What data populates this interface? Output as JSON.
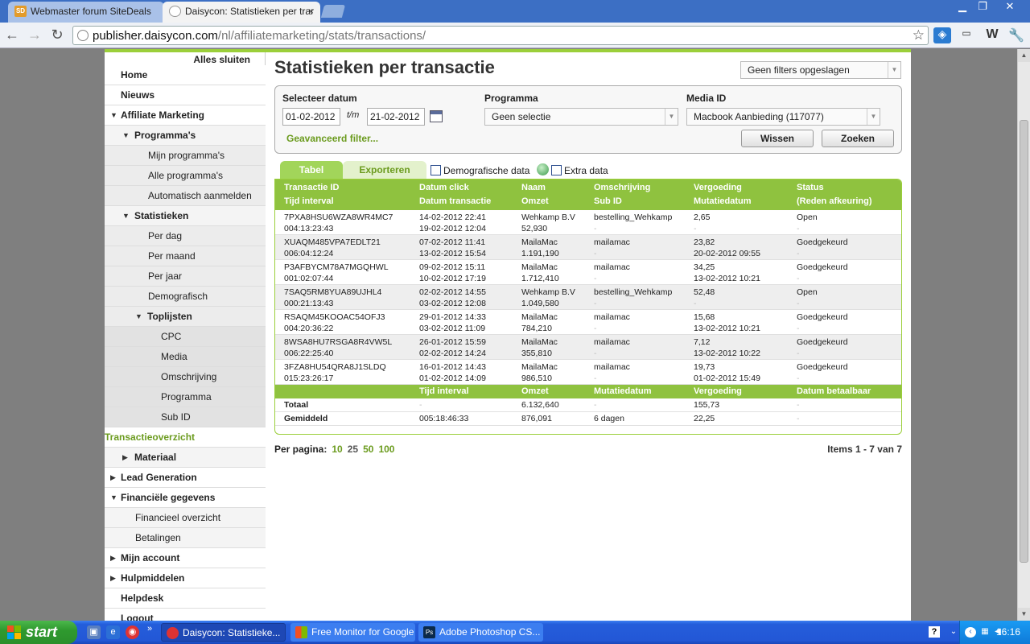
{
  "browser": {
    "tabs": [
      {
        "title": "Webmaster forum SiteDeals",
        "favicon": "SD"
      },
      {
        "title": "Daisycon: Statistieken per trar",
        "close": "×"
      }
    ],
    "window_controls": {
      "minimize": "▁",
      "maximize": "❐",
      "close": "✕"
    },
    "url_host": "publisher.daisycon.com",
    "url_path": "/nl/affiliatemarketing/stats/transactions/"
  },
  "sidebar": {
    "close_all": "Alles sluiten",
    "items": [
      {
        "label": "Home",
        "level": "l0",
        "arrow": ""
      },
      {
        "label": "Nieuws",
        "level": "l0",
        "arrow": ""
      },
      {
        "label": "Affiliate Marketing",
        "level": "l0",
        "arrow": "▼"
      },
      {
        "label": "Programma's",
        "level": "l1",
        "arrow": "▼"
      },
      {
        "label": "Mijn programma's",
        "level": "l2",
        "arrow": ""
      },
      {
        "label": "Alle programma's",
        "level": "l2",
        "arrow": ""
      },
      {
        "label": "Automatisch aanmelden",
        "level": "l2",
        "arrow": ""
      },
      {
        "label": "Statistieken",
        "level": "l1",
        "arrow": "▼"
      },
      {
        "label": "Per dag",
        "level": "l2",
        "arrow": ""
      },
      {
        "label": "Per maand",
        "level": "l2",
        "arrow": ""
      },
      {
        "label": "Per jaar",
        "level": "l2",
        "arrow": ""
      },
      {
        "label": "Demografisch",
        "level": "l2",
        "arrow": ""
      },
      {
        "label": "Toplijsten",
        "level": "l2b",
        "arrow": "▼"
      },
      {
        "label": "CPC",
        "level": "l3",
        "arrow": ""
      },
      {
        "label": "Media",
        "level": "l3",
        "arrow": ""
      },
      {
        "label": "Omschrijving",
        "level": "l3",
        "arrow": ""
      },
      {
        "label": "Programma",
        "level": "l3",
        "arrow": ""
      },
      {
        "label": "Sub ID",
        "level": "l3",
        "arrow": ""
      },
      {
        "label": "Transactieoverzicht",
        "level": "active",
        "arrow": ""
      },
      {
        "label": "Materiaal",
        "level": "l1",
        "arrow": "▶"
      },
      {
        "label": "Lead Generation",
        "level": "l0",
        "arrow": "▶"
      },
      {
        "label": "Financiële gegevens",
        "level": "l0",
        "arrow": "▼"
      },
      {
        "label": "Financieel overzicht",
        "level": "sub",
        "arrow": ""
      },
      {
        "label": "Betalingen",
        "level": "sub",
        "arrow": ""
      },
      {
        "label": "Mijn account",
        "level": "l0",
        "arrow": "▶"
      },
      {
        "label": "Hulpmiddelen",
        "level": "l0",
        "arrow": "▶"
      },
      {
        "label": "Helpdesk",
        "level": "l0",
        "arrow": ""
      },
      {
        "label": "Logout",
        "level": "l0",
        "arrow": ""
      }
    ]
  },
  "main": {
    "title": "Statistieken per transactie",
    "saved_filters": "Geen filters opgeslagen",
    "filter": {
      "date_label": "Selecteer datum",
      "date_from": "01-02-2012",
      "date_sep": "t/m",
      "date_to": "21-02-2012",
      "program_label": "Programma",
      "program_value": "Geen selectie",
      "media_label": "Media ID",
      "media_value": "Macbook Aanbieding (117077)",
      "advanced": "Geavanceerd filter...",
      "clear": "Wissen",
      "search": "Zoeken"
    },
    "view_tabs": {
      "table": "Tabel",
      "export": "Exporteren"
    },
    "checkboxes": {
      "demographic": "Demografische data",
      "extra": "Extra data"
    },
    "table": {
      "headers": [
        [
          "Transactie ID",
          "Tijd interval"
        ],
        [
          "Datum click",
          "Datum transactie"
        ],
        [
          "Naam",
          "Omzet"
        ],
        [
          "Omschrijving",
          "Sub ID"
        ],
        [
          "Vergoeding",
          "Mutatiedatum"
        ],
        [
          "Status",
          "(Reden afkeuring)"
        ]
      ],
      "rows": [
        [
          [
            "7PXA8HSU6WZA8WR4MC7",
            "004:13:23:43"
          ],
          [
            "14-02-2012 22:41",
            "19-02-2012 12:04"
          ],
          [
            "Wehkamp B.V",
            "52,930"
          ],
          [
            "bestelling_Wehkamp",
            "-"
          ],
          [
            "2,65",
            "-"
          ],
          [
            "Open",
            "-"
          ]
        ],
        [
          [
            "XUAQM485VPA7EDLT21",
            "006:04:12:24"
          ],
          [
            "07-02-2012 11:41",
            "13-02-2012 15:54"
          ],
          [
            "MailaMac",
            "1.191,190"
          ],
          [
            "mailamac",
            "-"
          ],
          [
            "23,82",
            "20-02-2012 09:55"
          ],
          [
            "Goedgekeurd",
            "-"
          ]
        ],
        [
          [
            "P3AFBYCM78A7MGQHWL",
            "001:02:07:44"
          ],
          [
            "09-02-2012 15:11",
            "10-02-2012 17:19"
          ],
          [
            "MailaMac",
            "1.712,410"
          ],
          [
            "mailamac",
            "-"
          ],
          [
            "34,25",
            "13-02-2012 10:21"
          ],
          [
            "Goedgekeurd",
            "-"
          ]
        ],
        [
          [
            "7SAQ5RM8YUA89UJHL4",
            "000:21:13:43"
          ],
          [
            "02-02-2012 14:55",
            "03-02-2012 12:08"
          ],
          [
            "Wehkamp B.V",
            "1.049,580"
          ],
          [
            "bestelling_Wehkamp",
            "-"
          ],
          [
            "52,48",
            "-"
          ],
          [
            "Open",
            "-"
          ]
        ],
        [
          [
            "RSAQM45KOOAC54OFJ3",
            "004:20:36:22"
          ],
          [
            "29-01-2012 14:33",
            "03-02-2012 11:09"
          ],
          [
            "MailaMac",
            "784,210"
          ],
          [
            "mailamac",
            "-"
          ],
          [
            "15,68",
            "13-02-2012 10:21"
          ],
          [
            "Goedgekeurd",
            "-"
          ]
        ],
        [
          [
            "8WSA8HU7RSGA8R4VW5L",
            "006:22:25:40"
          ],
          [
            "26-01-2012 15:59",
            "02-02-2012 14:24"
          ],
          [
            "MailaMac",
            "355,810"
          ],
          [
            "mailamac",
            "-"
          ],
          [
            "7,12",
            "13-02-2012 10:22"
          ],
          [
            "Goedgekeurd",
            "-"
          ]
        ],
        [
          [
            "3FZA8HU54QRA8J1SLDQ",
            "015:23:26:17"
          ],
          [
            "16-01-2012 14:43",
            "01-02-2012 14:09"
          ],
          [
            "MailaMac",
            "986,510"
          ],
          [
            "mailamac",
            "-"
          ],
          [
            "19,73",
            "01-02-2012 15:49"
          ],
          [
            "Goedgekeurd",
            "-"
          ]
        ]
      ],
      "summary_headers": [
        "",
        "Tijd interval",
        "Omzet",
        "Mutatiedatum",
        "Vergoeding",
        "Datum betaalbaar"
      ],
      "summary_rows": [
        [
          "Totaal",
          "-",
          "6.132,640",
          "-",
          "155,73",
          "-"
        ],
        [
          "Gemiddeld",
          "005:18:46:33",
          "876,091",
          "6 dagen",
          "22,25",
          "-"
        ]
      ]
    },
    "per_page_label": "Per pagina:",
    "per_page_options": [
      "10",
      "25",
      "50",
      "100"
    ],
    "per_page_current": "25",
    "items_count": "Items 1 - 7 van 7"
  },
  "taskbar": {
    "start": "start",
    "tasks": [
      {
        "title": "Daisycon: Statistieke...",
        "icon": "chrome"
      },
      {
        "title": "Free Monitor for Google",
        "icon": "windows"
      },
      {
        "title": "Adobe Photoshop CS...",
        "icon": "Ps"
      }
    ],
    "quicklaunch_more": "»",
    "clock": "16:16"
  }
}
